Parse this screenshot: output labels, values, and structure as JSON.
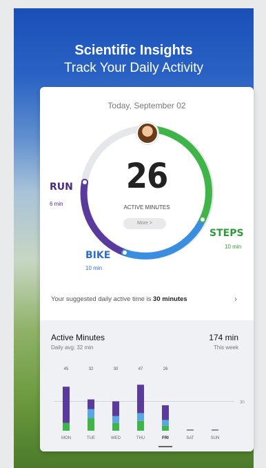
{
  "hero": {
    "title": "Scientific Insights",
    "subtitle": "Track Your Daily Activity"
  },
  "card": {
    "date": "Today, September 02",
    "total_minutes": "26",
    "total_label": "ACTIVE MINUTES",
    "more_label": "More >",
    "segments": [
      {
        "name": "RUN",
        "value": "6 min",
        "color": "#5b3a9e"
      },
      {
        "name": "BIKE",
        "value": "10 min",
        "color": "#3a8ee0"
      },
      {
        "name": "STEPS",
        "value": "10 min",
        "color": "#3fb549"
      }
    ],
    "suggestion_prefix": "Your suggested daily active time is ",
    "suggestion_value": "30 minutes",
    "suggestion_icon": "chevron-right-icon"
  },
  "weekly": {
    "title": "Active Minutes",
    "daily_avg": "Daily avg: 32 min",
    "total": "174 min",
    "total_label": "This week",
    "target_label": "30",
    "selected_day": "FRI"
  },
  "chart_data": {
    "type": "bar",
    "categories": [
      "MON",
      "TUE",
      "WED",
      "THU",
      "FRI",
      "SAT",
      "SUN"
    ],
    "totals": [
      "45",
      "32",
      "30",
      "47",
      "26",
      "",
      ""
    ],
    "series": [
      {
        "values": [
          8,
          13,
          8,
          10,
          5,
          0,
          0
        ],
        "color": "#3fb549"
      },
      {
        "values": [
          0,
          9,
          7,
          8,
          6,
          0,
          0
        ],
        "color": "#5aa7e8"
      },
      {
        "values": [
          37,
          10,
          15,
          29,
          15,
          0,
          0
        ],
        "color": "#5b3a9e"
      }
    ],
    "target": 30,
    "ylim": [
      0,
      55
    ]
  }
}
